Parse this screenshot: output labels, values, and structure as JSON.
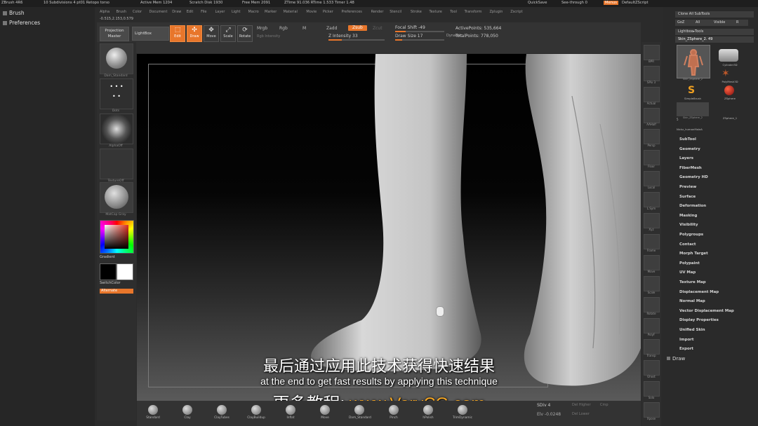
{
  "titlebar": {
    "app": "ZBrush 4R6",
    "subdiv_info": "10 Subdivisions 4 pt01 Retopo torso",
    "active_mem": "Active Mem 1204",
    "scratch_disk": "Scratch Disk 1930",
    "free_mem": "Free Mem 2091",
    "ztime": "ZTime 91.036 RTime 1.533 Timer 1.48",
    "quicksave": "QuickSave",
    "see_through": "See-through  0",
    "menus": "Menus",
    "default_zscript": "DefaultZScript"
  },
  "menubar": [
    "Alpha",
    "Brush",
    "Color",
    "Document",
    "Draw",
    "Edit",
    "File",
    "Layer",
    "Light",
    "Macro",
    "Marker",
    "Material",
    "Movie",
    "Picker",
    "Preferences",
    "Render",
    "Stencil",
    "Stroke",
    "Texture",
    "Tool",
    "Transform",
    "Zplugin",
    "Zscript"
  ],
  "left_palette": {
    "items": [
      "Brush",
      "Preferences"
    ],
    "coords": "-0.515,2.153,0.579"
  },
  "shelf": {
    "projection_master": "Projection Master",
    "lightbox": "LightBox",
    "tools": [
      "Edit",
      "Draw",
      "Move",
      "Scale",
      "Rotate"
    ],
    "mrgb": "Mrgb",
    "rgb": "Rgb",
    "m": "M",
    "zadd": "Zadd",
    "zsub": "Zsub",
    "zcut": "Zcut",
    "rgb_intensity": "Rgb Intensity",
    "z_intensity": "Z Intensity 33",
    "focal_shift": "Focal Shift -49",
    "draw_size": "Draw Size 17",
    "dynamic": "Dynamic",
    "active_points": "ActivePoints: 535,664",
    "total_points": "TotalPoints: 778,050"
  },
  "left_tray": {
    "thumbs": [
      "Dam_Standard",
      "Dots",
      "AlphaOff",
      "TextureOff",
      "MatCap Gray"
    ],
    "gradient": "Gradient",
    "switch_color": "SwitchColor",
    "alternate": "Alternate"
  },
  "right_tray": [
    "BPR",
    "SPix 3",
    "Actual",
    "AAHalf",
    "Persp",
    "Floor",
    "Local",
    "L.Sym",
    "Xyz",
    "Frame",
    "Move",
    "Scale",
    "Rotate",
    "PolyF",
    "Transp",
    "Ghost",
    "Solo",
    "Xpose"
  ],
  "right_palette": {
    "clone_all": "Clone All SubTools",
    "goz": "GoZ",
    "all": "All",
    "visible": "Visible",
    "r": "R",
    "lightbox_tools": "Lightbox▸Tools",
    "current_tool": "Skin_ZSphere_2. 49",
    "tools": [
      "Skin_ZSphere_2",
      "Cylinder3D",
      "PolyMesh3D",
      "SimpleBrush",
      "ZSphere",
      "Skin_ZSphere_2",
      "ZSphere_1",
      "Nickz_humanMaleA"
    ],
    "r_count": "5",
    "menus": [
      "SubTool",
      "Geometry",
      "Layers",
      "FiberMesh",
      "Geometry HD",
      "Preview",
      "Surface",
      "Deformation",
      "Masking",
      "Visibility",
      "Polygroups",
      "Contact",
      "Morph Target",
      "Polypaint",
      "UV Map",
      "Texture Map",
      "Displacement Map",
      "Normal Map",
      "Vector Displacement Map",
      "Display Properties",
      "Unified Skin",
      "Import",
      "Export"
    ],
    "draw": "Draw"
  },
  "bottom_shelf": {
    "brushes": [
      "Standard",
      "Clay",
      "ClayTubes",
      "ClayBuildup",
      "Inflat",
      "Move",
      "Dam_Standard",
      "Pinch",
      "hPolish",
      "TrimDynamic"
    ],
    "sdiv": "SDiv 4",
    "del_higher": "Del Higher",
    "del_lower": "Del Lower",
    "elv": "Elv -0.0248",
    "cmp": "Cmp"
  },
  "subtitles": {
    "chinese": "最后通过应用此技术获得快速结果",
    "english": "at the end to get fast results by applying this technique",
    "watermark_prefix": "更多教程:",
    "watermark_url": "www.VeryCG.com"
  },
  "colors": {
    "accent": "#e8762b",
    "watermark": "#f5a623",
    "panel": "#2a2a2a"
  }
}
